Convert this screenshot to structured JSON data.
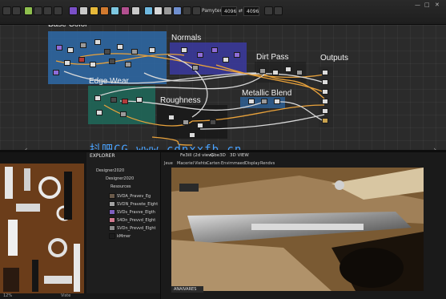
{
  "toolbar": {
    "size_label": "Pamyter Size",
    "size_value_1": "4096",
    "size_value_2": "4096"
  },
  "graph": {
    "frames": {
      "base_color": "Base Color",
      "normals": "Normals",
      "dirt_pass": "Dirt Pass",
      "outputs": "Outputs",
      "edge_wear": "Edge Wear",
      "roughness": "Roughness",
      "metallic_blend": "Metallic Blend"
    },
    "colors": {
      "graph_bg": "#2b2b2b",
      "base_color_frame": "#2e6aa8",
      "normals_frame": "#3b3aa0",
      "edge_wear_frame": "#1f6a5a",
      "roughness_frame": "#1f1f1f",
      "metallic_frame": "#2e6aa8",
      "wire_orange": "#e9a23b",
      "wire_white": "#d8d8d8"
    }
  },
  "watermark": "抖吧CG  www.cdnxxfb.cn",
  "explorer": {
    "title": "EXPLORER",
    "items": [
      "Designer2020",
      "Designer2020",
      "Resources",
      "SVDA_Pravev_Eg",
      "SVDN_Pravete_Elght",
      "SVDs_Pravve_Elgth",
      "S4Dn_Prevvd_Elght",
      "SVDn_Prevvd_Elght",
      "kMmer"
    ]
  },
  "viewport": {
    "tabs": [
      "Fe3ill (2d view)",
      "Gbe3D",
      "3D VIEW"
    ],
    "menu": [
      "Jeue",
      "Maceriel",
      "Viehts",
      "Carten",
      "Envirnmaed",
      "Display",
      "Rendvs"
    ],
    "footer_label": "ANAIVARES"
  },
  "status": {
    "zoom": "12%",
    "label": "Viste"
  }
}
